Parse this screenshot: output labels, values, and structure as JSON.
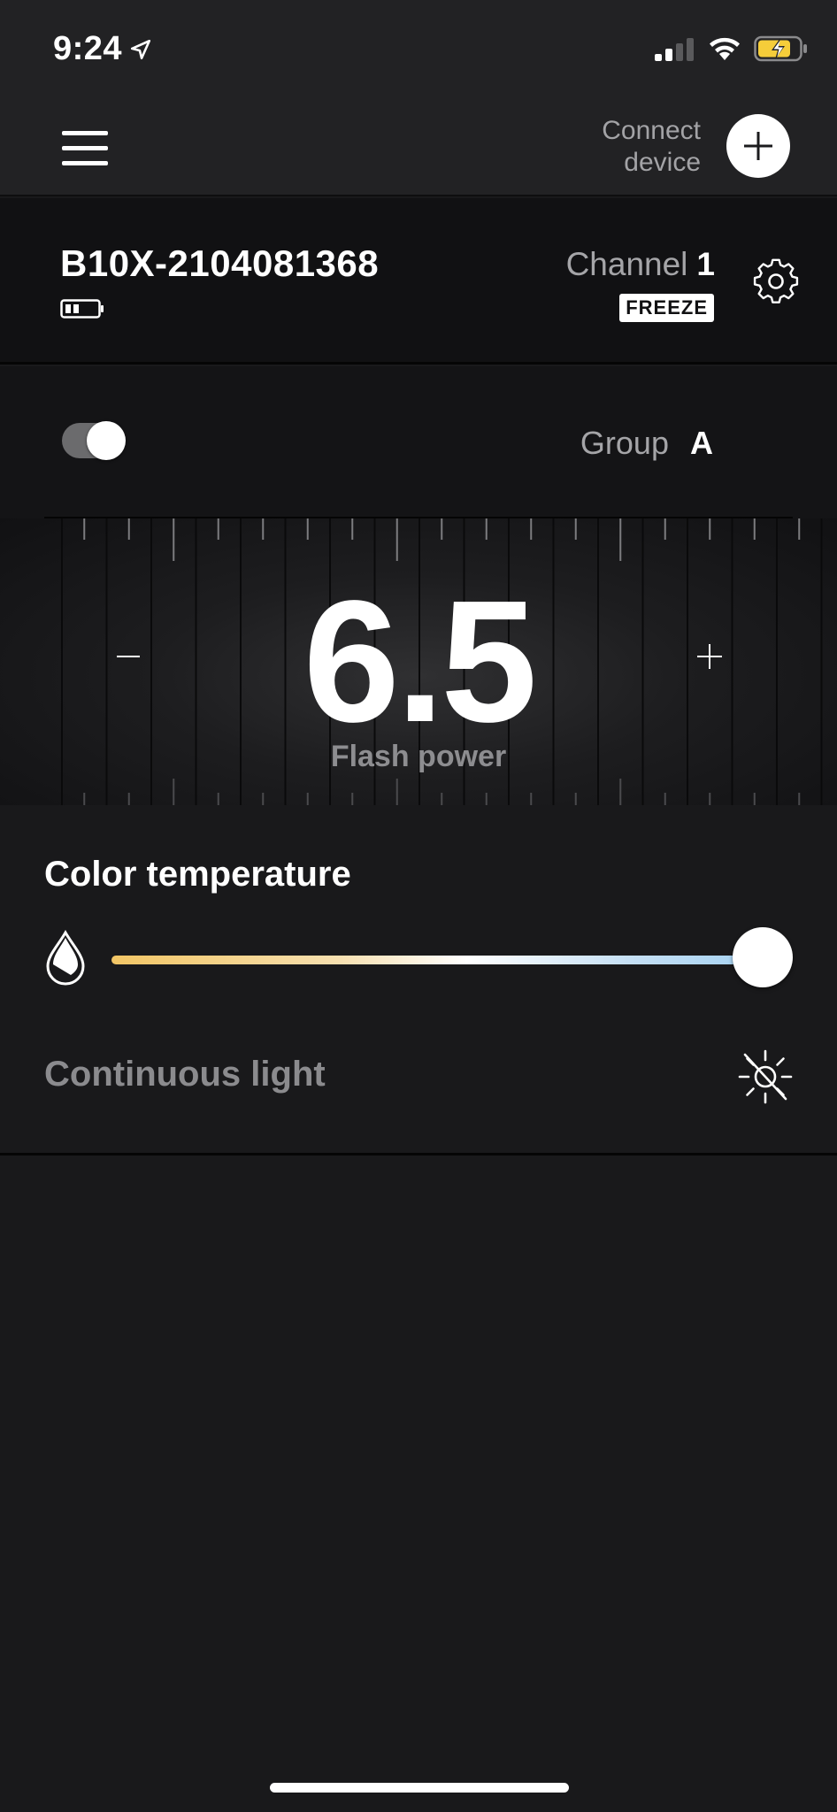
{
  "status_bar": {
    "time": "9:24",
    "icons": [
      "location-arrow-icon",
      "cellular-signal-icon",
      "wifi-icon",
      "battery-charging-icon"
    ],
    "battery_color": "#f5cd3a"
  },
  "header": {
    "menu_icon": "hamburger-menu-icon",
    "connect_line1": "Connect",
    "connect_line2": "device",
    "connect_icon": "plus-icon"
  },
  "device": {
    "name": "B10X-2104081368",
    "battery_icon": "device-battery-icon",
    "battery_level": 0.5,
    "channel_label": "Channel",
    "channel_value": "1",
    "badge": "FREEZE",
    "settings_icon": "gear-icon"
  },
  "group": {
    "enabled": true,
    "label": "Group",
    "value": "A"
  },
  "flash": {
    "value": "6.5",
    "label": "Flash power",
    "decrement_label": "–",
    "increment_label": "+"
  },
  "color_temperature": {
    "title": "Color temperature",
    "icon": "droplet-icon",
    "level": 1.0,
    "gradient_colors": [
      "#f2c565",
      "#f7e0b0",
      "#ffffff",
      "#c6e0f5",
      "#a5d2f2"
    ]
  },
  "continuous_light": {
    "label": "Continuous light",
    "icon": "light-off-icon",
    "enabled": false
  }
}
